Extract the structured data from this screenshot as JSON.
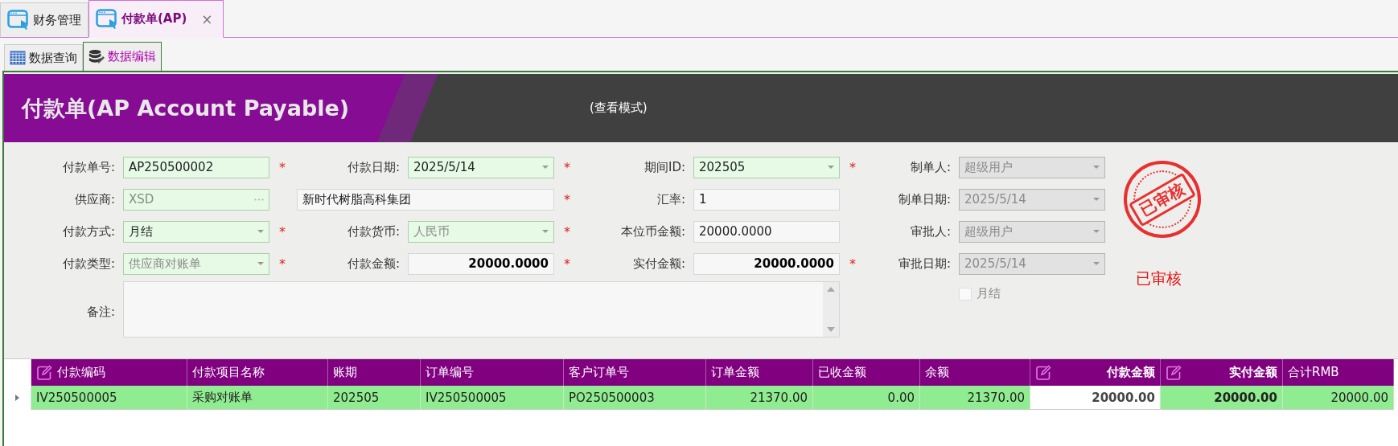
{
  "tabs": [
    {
      "label": "财务管理",
      "selected": false
    },
    {
      "label": "付款单(AP)",
      "selected": true,
      "close": "×"
    }
  ],
  "subtabs": [
    {
      "label": "数据查询",
      "kind": "grid",
      "selected": false
    },
    {
      "label": "数据编辑",
      "kind": "database",
      "selected": true
    }
  ],
  "header": {
    "title": "付款单(AP Account Payable)",
    "mode": "(查看模式)"
  },
  "form": {
    "rows": [
      [
        {
          "label": "付款单号:",
          "value": "AP250500002",
          "kind": "text",
          "editable": true,
          "disabled": false,
          "dim": false,
          "bold": false,
          "mark": "*"
        },
        {
          "label": "付款日期:",
          "value": "2025/5/14",
          "kind": "select",
          "editable": true,
          "disabled": false,
          "dim": false,
          "bold": false,
          "mark": "*"
        },
        {
          "label": "期间ID:",
          "value": "202505",
          "kind": "select",
          "editable": true,
          "disabled": false,
          "dim": false,
          "bold": false,
          "mark": "*"
        },
        {
          "label": "制单人:",
          "value": "超级用户",
          "kind": "select",
          "editable": false,
          "disabled": true,
          "dim": true,
          "bold": false
        }
      ],
      [
        {
          "label": "供应商:",
          "value": "XSD",
          "kind": "lookup",
          "editable": true,
          "disabled": false,
          "dim": true,
          "bold": false
        },
        {
          "value": "新时代树脂高科集团",
          "kind": "name",
          "editable": false,
          "disabled": false,
          "dim": false,
          "bold": false,
          "mark": "*"
        },
        {
          "label": "汇率:",
          "value": "1",
          "kind": "text",
          "editable": false,
          "disabled": false,
          "dim": false,
          "bold": false
        },
        {
          "label": "制单日期:",
          "value": "2025/5/14",
          "kind": "select",
          "editable": false,
          "disabled": true,
          "dim": true,
          "bold": false
        }
      ],
      [
        {
          "label": "付款方式:",
          "value": "月结",
          "kind": "select",
          "editable": true,
          "disabled": false,
          "dim": false,
          "bold": false,
          "mark": "*"
        },
        {
          "label": "付款货币:",
          "value": "人民币",
          "kind": "select",
          "editable": true,
          "disabled": false,
          "dim": true,
          "bold": false,
          "mark": "*"
        },
        {
          "label": "本位币金额:",
          "value": "20000.0000",
          "kind": "text",
          "editable": false,
          "disabled": false,
          "dim": false,
          "bold": false
        },
        {
          "label": "审批人:",
          "value": "超级用户",
          "kind": "select",
          "editable": false,
          "disabled": true,
          "dim": true,
          "bold": false
        }
      ],
      [
        {
          "label": "付款类型:",
          "value": "供应商对账单",
          "kind": "select",
          "editable": true,
          "disabled": false,
          "dim": true,
          "bold": false,
          "mark": "*"
        },
        {
          "label": "付款金额:",
          "value": "20000.0000",
          "kind": "number",
          "editable": false,
          "disabled": false,
          "dim": false,
          "bold": true,
          "mark": "*"
        },
        {
          "label": "实付金额:",
          "value": "20000.0000",
          "kind": "number",
          "editable": false,
          "disabled": false,
          "dim": false,
          "bold": true,
          "mark": "*"
        },
        {
          "label": "审批日期:",
          "value": "2025/5/14",
          "kind": "select",
          "editable": false,
          "disabled": true,
          "dim": true,
          "bold": false
        }
      ],
      [
        {
          "label": "备注:",
          "kind": "memo",
          "editable": false,
          "disabled": false
        }
      ]
    ],
    "monthly_check": {
      "text": "月结",
      "checked": false,
      "dim": true
    },
    "stamp": {
      "text": "已审核"
    },
    "status": "已审核"
  },
  "table": {
    "columns": [
      {
        "label": "付款编码",
        "kind": "text",
        "editable": true,
        "bold": false,
        "active": false
      },
      {
        "label": "付款项目名称",
        "kind": "text",
        "editable": false,
        "bold": false,
        "active": false
      },
      {
        "label": "账期",
        "kind": "text",
        "editable": false,
        "bold": false,
        "active": false
      },
      {
        "label": "订单编号",
        "kind": "text",
        "editable": false,
        "bold": false,
        "active": false
      },
      {
        "label": "客户订单号",
        "kind": "text",
        "editable": false,
        "bold": false,
        "active": false
      },
      {
        "label": "订单金额",
        "kind": "amount",
        "editable": false,
        "bold": false,
        "active": false
      },
      {
        "label": "已收金额",
        "kind": "amount",
        "editable": false,
        "bold": false,
        "active": false
      },
      {
        "label": "余额",
        "kind": "amount",
        "editable": false,
        "bold": false,
        "active": false
      },
      {
        "label": "付款金额",
        "kind": "amount",
        "editable": true,
        "bold": true,
        "active": true
      },
      {
        "label": "实付金额",
        "kind": "amount",
        "editable": true,
        "bold": true,
        "active": false
      },
      {
        "label": "合计RMB",
        "kind": "amount",
        "editable": false,
        "bold": false,
        "active": false
      }
    ],
    "rows": [
      {
        "current": true,
        "cells": [
          "IV250500005",
          "采购对账单",
          "202505",
          "IV250500005",
          "PO250500003",
          "21370.00",
          "0.00",
          "21370.00",
          "20000.00",
          "20000.00",
          "20000.00"
        ]
      }
    ]
  }
}
